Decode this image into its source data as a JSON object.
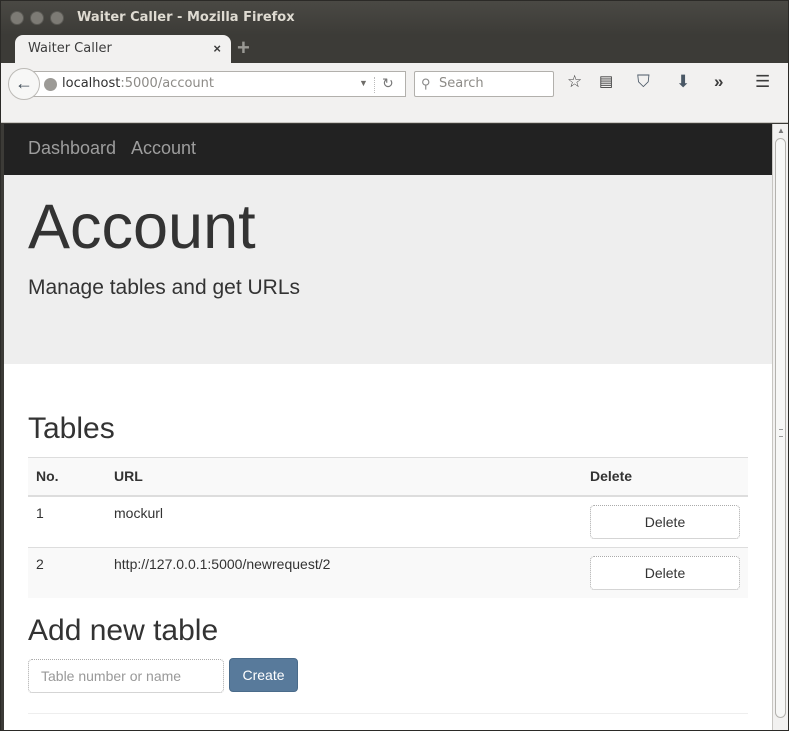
{
  "window": {
    "title": "Waiter Caller - Mozilla Firefox",
    "controls": [
      "close",
      "minimize",
      "maximize"
    ]
  },
  "browser": {
    "tab": {
      "label": "Waiter Caller",
      "close_icon": "×"
    },
    "new_tab_icon": "+",
    "url": {
      "host": "localhost",
      "rest": ":5000/account"
    },
    "search_placeholder": "Search",
    "toolbar_icons": [
      "bookmark-star-icon",
      "reading-list-icon",
      "pocket-icon",
      "download-icon",
      "overflow-icon",
      "menu-icon"
    ]
  },
  "nav": {
    "items": [
      {
        "label": "Dashboard"
      },
      {
        "label": "Account"
      }
    ]
  },
  "jumbotron": {
    "title": "Account",
    "subtitle": "Manage tables and get URLs"
  },
  "tables_section": {
    "heading": "Tables",
    "columns": [
      "No.",
      "URL",
      "Delete"
    ],
    "rows": [
      {
        "no": "1",
        "url": "mockurl",
        "action": "Delete"
      },
      {
        "no": "2",
        "url": "http://127.0.0.1:5000/newrequest/2",
        "action": "Delete"
      }
    ]
  },
  "add_section": {
    "heading": "Add new table",
    "input_placeholder": "Table number or name",
    "input_value": "",
    "create_label": "Create"
  },
  "colors": {
    "navbar_bg": "#222222",
    "jumbotron_bg": "#eeeeee",
    "primary_button": "#587a9b"
  }
}
